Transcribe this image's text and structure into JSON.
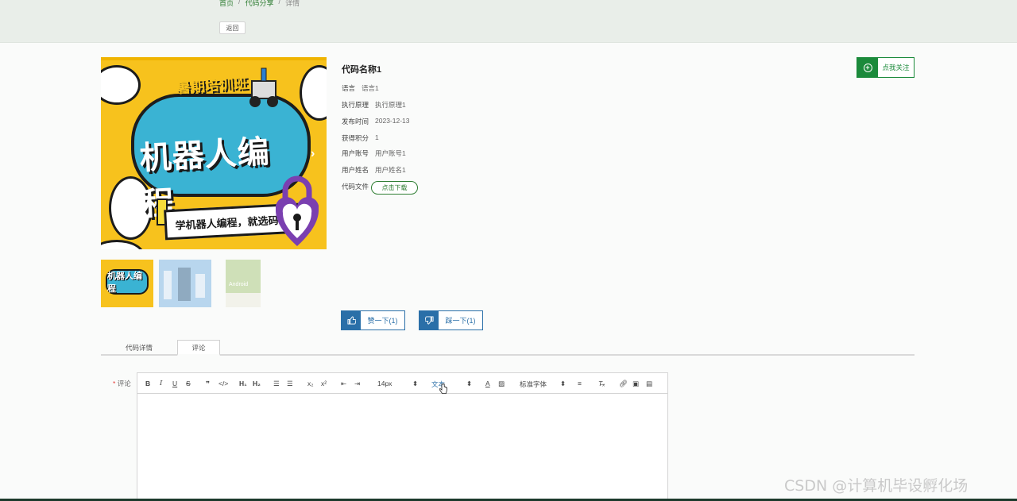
{
  "breadcrumb": {
    "home": "首页",
    "section": "代码分享",
    "current": "详情"
  },
  "back_label": "返回",
  "banner": {
    "subtitle": "暑期培训班",
    "title": "机器人编程",
    "tagline": "学机器人编程，就选码高",
    "next_icon": "chevron-right-icon"
  },
  "thumbs": [
    {
      "label": "机器人编程"
    },
    {
      "label": ""
    },
    {
      "label": "Android"
    }
  ],
  "detail": {
    "name": "代码名称1",
    "rows": [
      {
        "label": "语言",
        "value": "语言1"
      },
      {
        "label": "执行原理",
        "value": "执行原理1"
      },
      {
        "label": "发布时间",
        "value": "2023-12-13"
      },
      {
        "label": "获得积分",
        "value": "1"
      },
      {
        "label": "用户账号",
        "value": "用户账号1"
      },
      {
        "label": "用户姓名",
        "value": "用户姓名1"
      }
    ],
    "file_label": "代码文件",
    "download_label": "点击下载"
  },
  "follow_label": "点我关注",
  "vote": {
    "up": "赞一下(1)",
    "down": "踩一下(1)"
  },
  "tabs": [
    {
      "label": "代码详情"
    },
    {
      "label": "评论"
    }
  ],
  "comment": {
    "label": "评论",
    "required": "*",
    "toolbar": {
      "size": "14px",
      "style": "文本",
      "font": "标准字体"
    }
  },
  "watermark": "CSDN @计算机毕设孵化场",
  "colors": {
    "accent_green": "#1b8a3b",
    "accent_blue": "#2a6fa8"
  }
}
